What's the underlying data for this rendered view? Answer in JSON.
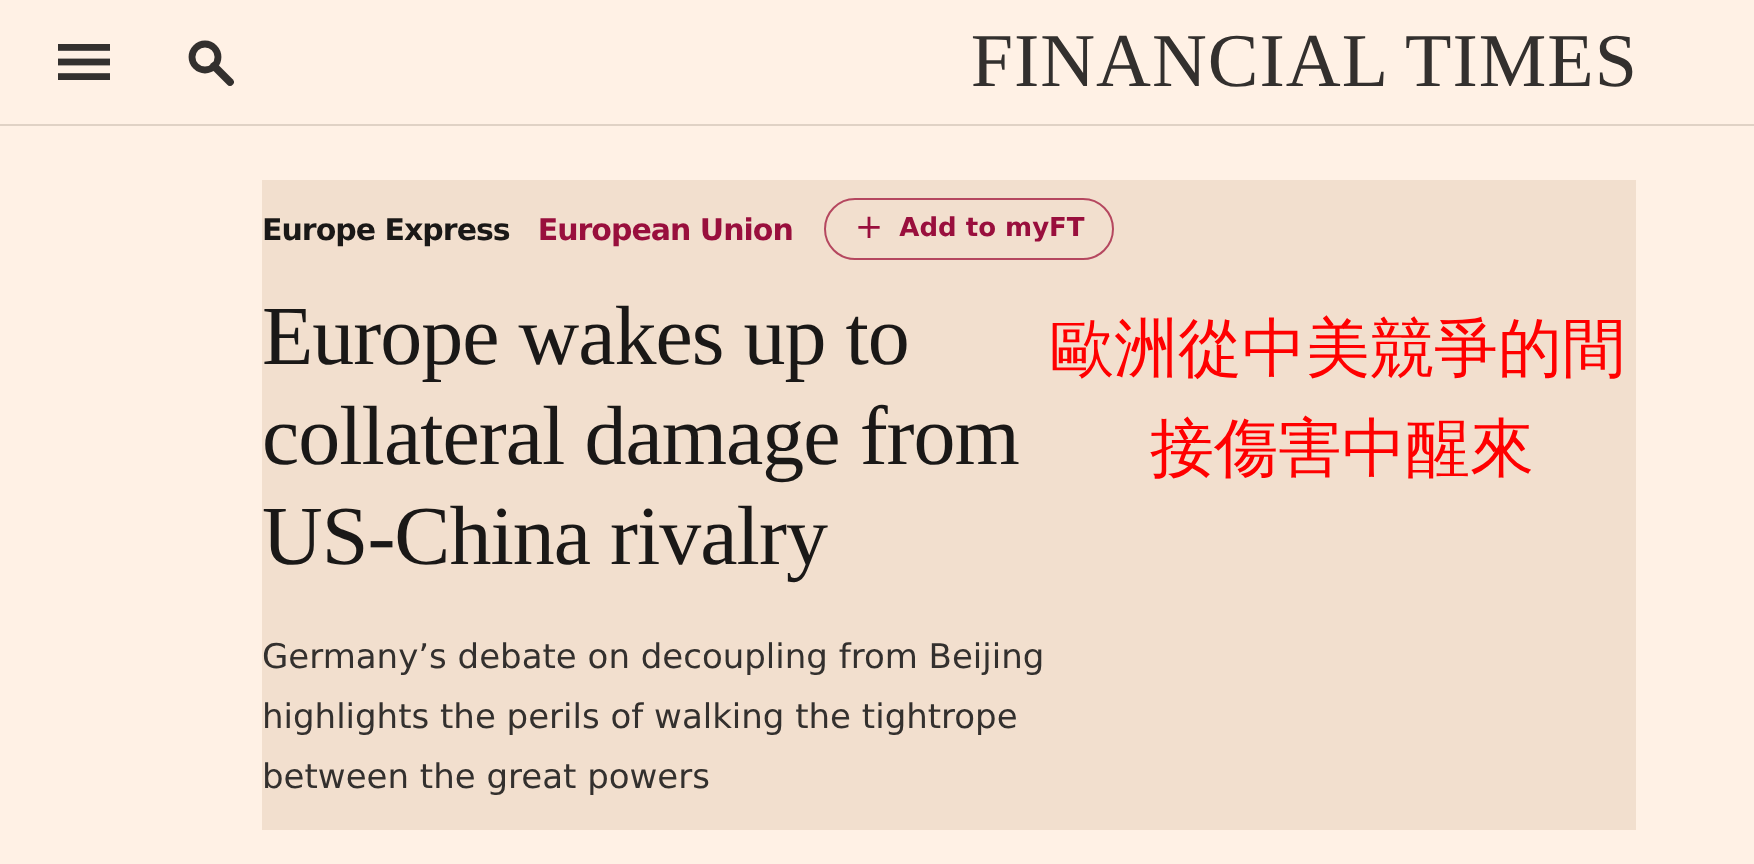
{
  "header": {
    "logo": "FINANCIAL TIMES"
  },
  "article": {
    "series": "Europe Express",
    "topic": "European Union",
    "follow_button": {
      "icon": "+",
      "label": "Add to myFT"
    },
    "headline": "Europe wakes up to collateral damage from US-China rivalry",
    "standfirst": "Germany’s debate on decoupling from Beijing highlights the perils of walking the tightrope between the great powers"
  },
  "annotation": {
    "lines": [
      "歐洲從中美競爭的間",
      "接傷害中醒來"
    ]
  }
}
